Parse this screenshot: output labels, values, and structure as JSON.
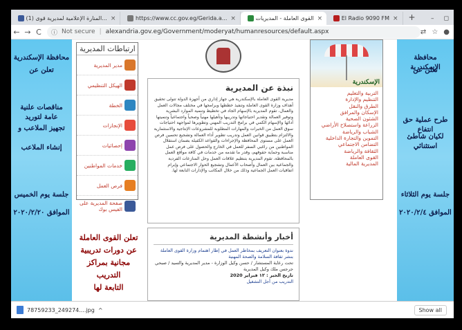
{
  "browser": {
    "tabs": [
      {
        "title": "(1) المنارة الإعلامية لمديرية قوى...",
        "active": false,
        "fav_color": "#3b5998"
      },
      {
        "title": "https://www.cc.gov.eg/Gerida.a...",
        "active": false,
        "fav_color": "#777777"
      },
      {
        "title": "القوى العاملة - المديريات",
        "active": true,
        "fav_color": "#2b8a3e"
      },
      {
        "title": "El Radio 9090 FM",
        "active": false,
        "fav_color": "#b71c1c"
      }
    ],
    "tab_close": "×",
    "new_tab": "+",
    "window_controls": [
      "–",
      "◻"
    ],
    "address": {
      "security": "Not secure",
      "url": "alexandria.gov.eg/Government/moderyat/humanresources/default.aspx"
    }
  },
  "left_banner": {
    "line1": "محافظة الإسكندرية",
    "line2": "تعلن عن",
    "line3": "مناقصات علنية عامة لتوريد",
    "line4": "تجهيز الملاعب و",
    "line5": "إنشاء الملاعب",
    "line6": "جلسة يوم الخميس",
    "line7": "الموافق ٢٠٢٠/٢/٢٠"
  },
  "right_banner": {
    "line1": "محافظة الإسكندرية",
    "line2": "تعلن عن",
    "line3": "طرح عملية حق انتفاع",
    "line4": "لكيان شاطئ استثنائي",
    "line5": "جلسة يوم الثلاثاء",
    "line6": "الموافق ٢٠٢٠/٢/٤"
  },
  "links_menu": {
    "title": "ارتباطات المديرية",
    "items": [
      {
        "label": "مدير المديرية",
        "icon": "person-icon",
        "color": "#d9772b"
      },
      {
        "label": "الهيكل التنظيمي",
        "icon": "org-chart-icon",
        "color": "#c0392b"
      },
      {
        "label": "الخطة",
        "icon": "plan-icon",
        "color": "#2e86c1"
      },
      {
        "label": "الإنجازات",
        "icon": "achievements-icon",
        "color": "#e74c3c"
      },
      {
        "label": "إحصائيات",
        "icon": "stats-icon",
        "color": "#8e44ad"
      },
      {
        "label": "خدمات المواطنين",
        "icon": "services-icon",
        "color": "#27ae60"
      },
      {
        "label": "فرص العمل",
        "icon": "jobs-icon",
        "color": "#e67e22"
      },
      {
        "label": "صفحة المديرية على الفيس بوك",
        "icon": "facebook-icon",
        "color": "#3b5998"
      }
    ]
  },
  "promo": {
    "line1": "تعلن القوى العاملة",
    "line2": "عن دورات تدريبية",
    "line3": "مجانية بمراكز التدريب",
    "line4": "التابعة لها"
  },
  "about": {
    "title": "نبذة عن المديرية",
    "text": "مديرية القوى العاملة بالإسكندرية هي جهاز إداري من أجهزة الدولة تتولى تحقيق أهداف وزارة القوى العاملة وتنفيذ خططها وبرامجها في مختلف مجالات العمل والعمال، تقوم المديرية بالإسهام الجاد في تخطيط وتنمية الموارد البشرية وتوفير العمالة وتقدير احتياجاتها وتدريبها وتأهيلها مهنياً وصحياً واجتماعياً وتنميتها آدائها والإسهام الكمي في برامج التدريب المهني وتطويرها لمواجهة احتياجات سوق العمل من الخبرات والمهارات المطلوبة للمشروعات الإنتاجية والاستثمارية والالتزام بتطبيق قوانين العمل وتدريب تطوير أداء العمالة وتشجيع تحسين فرص العمل على مستوى المحافظة والإجراءات والقواعد الكفيلة بضمان استقلال المواطنين من راغبي السفر للعمل في الخارج والحصول على فرص عمل مناسبة وحماية حقوقهم، وقدر ما تقدمه من خدمات في كافة مواقع العمل بالمحافظة، تقوم المديرية بتنظيم علاقات العمل وحل المنازعات الفردية والجماعية بين العمال وأصحاب الأعمال وتشجيع الحوار الاجتماعي وإبرام اتفاقيات العمل الجماعية وذلك من خلال المكاتب والإدارات التابعة لها."
  },
  "news": {
    "title": "أخبار وأنشطة المديرية",
    "item1": "ندوة بعنوان التعريف بمخاطر العمل في إطار اهتمام وزارة القوى العاملة بنشر ثقافة السلامة والصحة المهنية",
    "item2": "تحت رعاية المستشار / حسن وكيل الوزارة - مدير المديرية والسيد / صبحي جرجس ملك وكيل المديرية",
    "date": "تاريخ الخبر : ١٢ فبراير 2020",
    "item3": "التدريب من أجل التشغيل"
  },
  "sectors": {
    "caption": "الإسكندرية",
    "items": [
      "التربية والتعليم",
      "التنظيم والإدارة",
      "الطرق والنقل",
      "الإسكان والمرافق",
      "الشئون الصحية",
      "الزراعة واستصلاح الأراضي",
      "الشباب والرياضة",
      "التموين والتجارة الداخلية",
      "التضامن الاجتماعي",
      "الثقافة والرياضة",
      "القوى العاملة",
      "المديرية المالية"
    ]
  },
  "downloads": {
    "file": "78759233_249274....jpg",
    "chevron": "^",
    "show_all": "Show all"
  }
}
